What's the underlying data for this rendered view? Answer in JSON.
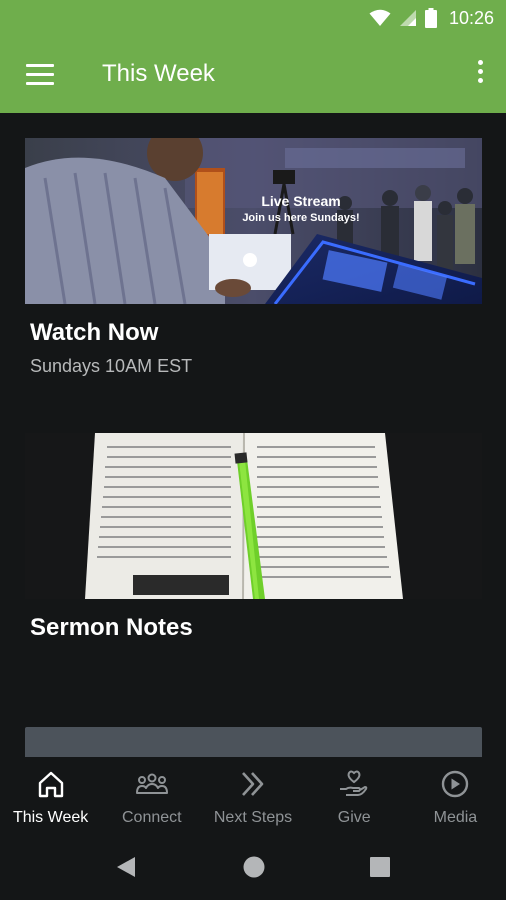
{
  "status_bar": {
    "time": "10:26"
  },
  "app_bar": {
    "title": "This Week"
  },
  "cards": [
    {
      "title": "Watch Now",
      "subtitle": "Sundays 10AM EST",
      "image_overlay": {
        "line1": "Live Stream",
        "line2": "Join us here Sundays!"
      }
    },
    {
      "title": "Sermon Notes"
    }
  ],
  "bottom_nav": {
    "items": [
      {
        "label": "This Week",
        "icon": "home-icon",
        "active": true
      },
      {
        "label": "Connect",
        "icon": "group-icon"
      },
      {
        "label": "Next Steps",
        "icon": "double-chevron-icon"
      },
      {
        "label": "Give",
        "icon": "heart-hand-icon"
      },
      {
        "label": "Media",
        "icon": "play-circle-icon"
      }
    ]
  },
  "colors": {
    "accent": "#6fae4c",
    "background": "#141617",
    "nav_inactive": "#8f9396"
  }
}
